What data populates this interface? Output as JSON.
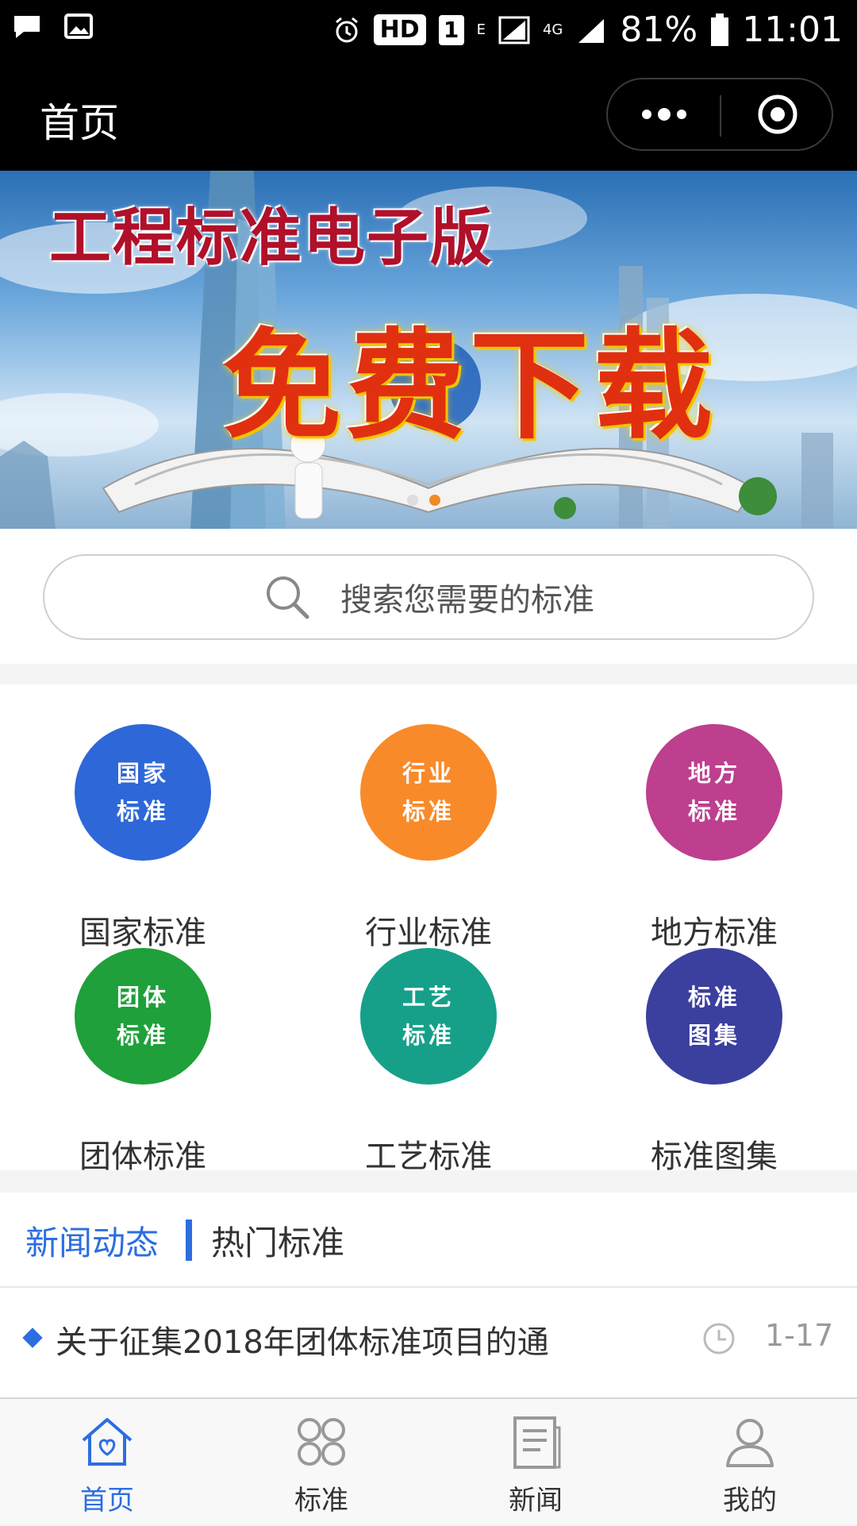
{
  "status_bar": {
    "battery": "81%",
    "time": "11:01",
    "hd": "HD",
    "sim": "1",
    "net_e": "E",
    "net_4g": "4G"
  },
  "header": {
    "title": "首页"
  },
  "banner": {
    "title": "工程标准电子版",
    "subtitle": "免费下载"
  },
  "search": {
    "placeholder": "搜索您需要的标准"
  },
  "categories": [
    {
      "label": "国家标准",
      "line1": "国家",
      "line2": "标准",
      "color": "#2e67d8"
    },
    {
      "label": "行业标准",
      "line1": "行业",
      "line2": "标准",
      "color": "#f98a2a"
    },
    {
      "label": "地方标准",
      "line1": "地方",
      "line2": "标准",
      "color": "#bd3f8e"
    },
    {
      "label": "团体标准",
      "line1": "团体",
      "line2": "标准",
      "color": "#1fa03a"
    },
    {
      "label": "工艺标准",
      "line1": "工艺",
      "line2": "标准",
      "color": "#16a08a"
    },
    {
      "label": "标准图集",
      "line1": "标准",
      "line2": "图集",
      "color": "#3b3f9e"
    }
  ],
  "news": {
    "tab_news": "新闻动态",
    "tab_hot": "热门标准",
    "items": [
      {
        "title": "关于征集2018年团体标准项目的通",
        "date": "1-17"
      }
    ]
  },
  "tabbar": {
    "items": [
      {
        "label": "首页",
        "icon": "home-icon",
        "active": true
      },
      {
        "label": "标准",
        "icon": "grid-icon",
        "active": false
      },
      {
        "label": "新闻",
        "icon": "news-icon",
        "active": false
      },
      {
        "label": "我的",
        "icon": "user-icon",
        "active": false
      }
    ]
  },
  "colors": {
    "accent": "#2c6ee0"
  }
}
